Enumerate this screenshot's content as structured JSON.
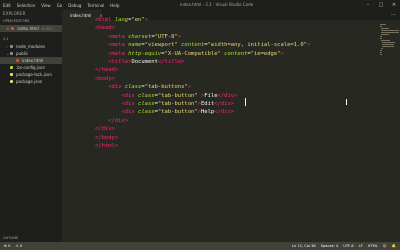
{
  "window": {
    "title": "index.html - 2.1 - Visual Studio Code",
    "menu": [
      "Edit",
      "Selection",
      "View",
      "Go",
      "Debug",
      "Terminal",
      "Help"
    ],
    "controls": [
      "–",
      "□",
      "×"
    ]
  },
  "sidebar": {
    "header": "EXPLORER",
    "open_editors_header": "OPEN EDITORS",
    "open_editor": {
      "name": "index.html",
      "path": "public"
    },
    "project_header": "2.1",
    "tree": [
      {
        "name": "node_modules",
        "color": "#908f85",
        "expand": "›",
        "selected": false
      },
      {
        "name": "public",
        "color": "#908f85",
        "expand": "⌄",
        "selected": false
      },
      {
        "name": "index.html",
        "color": "#e44d26",
        "expand": "",
        "selected": true
      },
      {
        "name": ".bs-config.json",
        "color": "#a6e22e",
        "expand": "",
        "selected": false
      },
      {
        "name": "package-lock.json",
        "color": "#e6db74",
        "expand": "",
        "selected": false
      },
      {
        "name": "package.json",
        "color": "#e6db74",
        "expand": "",
        "selected": false
      }
    ],
    "outline_header": "OUTLINE"
  },
  "tab": {
    "label": "index.html",
    "close": "×"
  },
  "editor_actions": "⋯",
  "code": {
    "line_numbers": [
      "",
      "",
      "",
      "",
      "",
      "",
      "",
      "",
      "",
      "",
      "",
      "",
      "",
      "",
      "",
      "",
      ""
    ],
    "lines": [
      [
        {
          "t": "<html ",
          "c": "tag"
        },
        {
          "t": "lang",
          "c": "attr"
        },
        {
          "t": "=",
          "c": "punct"
        },
        {
          "t": "\"en\"",
          "c": "str"
        },
        {
          "t": ">",
          "c": "tag"
        }
      ],
      [
        {
          "t": "<head>",
          "c": "tag"
        }
      ],
      [
        {
          "t": "    <meta ",
          "c": "tag"
        },
        {
          "t": "charset",
          "c": "attr"
        },
        {
          "t": "=",
          "c": "punct"
        },
        {
          "t": "\"UTF-8\"",
          "c": "str"
        },
        {
          "t": ">",
          "c": "tag"
        }
      ],
      [
        {
          "t": "    <meta ",
          "c": "tag"
        },
        {
          "t": "name",
          "c": "attr"
        },
        {
          "t": "=",
          "c": "punct"
        },
        {
          "t": "\"viewport\" ",
          "c": "str"
        },
        {
          "t": "content",
          "c": "attr"
        },
        {
          "t": "=",
          "c": "punct"
        },
        {
          "t": "\"width=any, initial-scale=1.0\"",
          "c": "str"
        },
        {
          "t": ">",
          "c": "tag"
        }
      ],
      [
        {
          "t": "    <meta ",
          "c": "tag"
        },
        {
          "t": "http-equiv",
          "c": "attr"
        },
        {
          "t": "=",
          "c": "punct"
        },
        {
          "t": "\"X-UA-Compatible\" ",
          "c": "str"
        },
        {
          "t": "content",
          "c": "attr"
        },
        {
          "t": "=",
          "c": "punct"
        },
        {
          "t": "\"ie=edge\"",
          "c": "str"
        },
        {
          "t": ">",
          "c": "tag"
        }
      ],
      [
        {
          "t": "    <title>",
          "c": "tag"
        },
        {
          "t": "Document",
          "c": "txt"
        },
        {
          "t": "</title>",
          "c": "tag"
        }
      ],
      [
        {
          "t": "</head>",
          "c": "tag"
        }
      ],
      [
        {
          "t": "<body>",
          "c": "tag"
        }
      ],
      [
        {
          "t": "    <div ",
          "c": "tag"
        },
        {
          "t": "class",
          "c": "attr"
        },
        {
          "t": "=",
          "c": "punct"
        },
        {
          "t": "\"tab-buttons\"",
          "c": "str"
        },
        {
          "t": ">",
          "c": "tag"
        }
      ],
      [
        {
          "t": "        <div ",
          "c": "tag"
        },
        {
          "t": "class",
          "c": "attr"
        },
        {
          "t": "=",
          "c": "punct"
        },
        {
          "t": "\"tab-button\"",
          "c": "str"
        },
        {
          "t": " >",
          "c": "tag"
        },
        {
          "t": "File",
          "c": "txt"
        },
        {
          "t": "</div>",
          "c": "tag"
        }
      ],
      [
        {
          "t": "        <div ",
          "c": "tag"
        },
        {
          "t": "class",
          "c": "attr"
        },
        {
          "t": "=",
          "c": "punct"
        },
        {
          "t": "\"tab-button\"",
          "c": "str"
        },
        {
          "t": ">",
          "c": "tag"
        },
        {
          "t": "Edit",
          "c": "txt"
        },
        {
          "t": "</div>",
          "c": "tag"
        }
      ],
      [
        {
          "t": "        <div ",
          "c": "tag"
        },
        {
          "t": "class",
          "c": "attr"
        },
        {
          "t": "=",
          "c": "punct"
        },
        {
          "t": "\"tab-button\"",
          "c": "str"
        },
        {
          "t": ">",
          "c": "tag"
        },
        {
          "t": "Help",
          "c": "txt"
        },
        {
          "t": "</div>",
          "c": "tag"
        }
      ],
      [
        {
          "t": "    </div>",
          "c": "tag"
        }
      ],
      [
        {
          "t": "</div>",
          "c": "tag"
        }
      ],
      [
        {
          "t": "</body>",
          "c": "tag"
        }
      ],
      [
        {
          "t": "</html>",
          "c": "tag"
        }
      ],
      []
    ]
  },
  "status": {
    "left": [
      "⊗ 0",
      "⚠ 0"
    ],
    "right": [
      "Ln 11, Col 38",
      "Spaces: 4",
      "UTF-8",
      "LF",
      "HTML",
      "☺",
      "🔔"
    ]
  }
}
